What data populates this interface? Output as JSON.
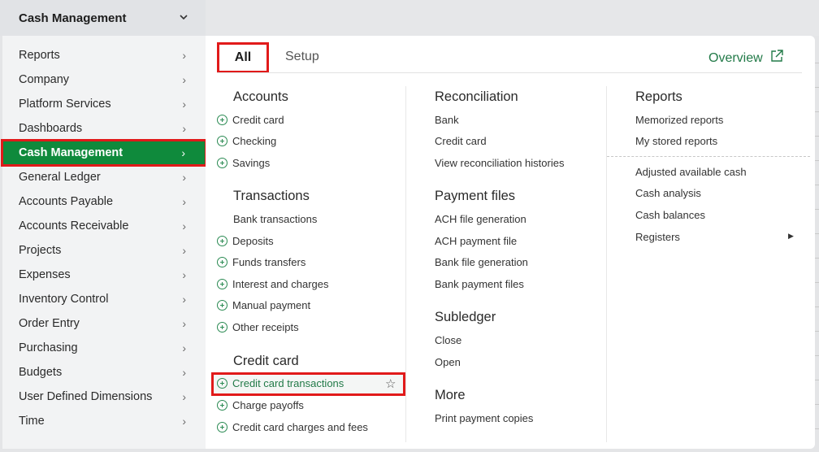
{
  "header": {
    "module": "Cash Management"
  },
  "sidebar": {
    "items": [
      {
        "label": "Reports",
        "key": "reports"
      },
      {
        "label": "Company",
        "key": "company"
      },
      {
        "label": "Platform Services",
        "key": "platform-services"
      },
      {
        "label": "Dashboards",
        "key": "dashboards"
      },
      {
        "label": "Cash Management",
        "key": "cash-management",
        "active": true
      },
      {
        "label": "General Ledger",
        "key": "general-ledger"
      },
      {
        "label": "Accounts Payable",
        "key": "accounts-payable"
      },
      {
        "label": "Accounts Receivable",
        "key": "accounts-receivable"
      },
      {
        "label": "Projects",
        "key": "projects"
      },
      {
        "label": "Expenses",
        "key": "expenses"
      },
      {
        "label": "Inventory Control",
        "key": "inventory-control"
      },
      {
        "label": "Order Entry",
        "key": "order-entry"
      },
      {
        "label": "Purchasing",
        "key": "purchasing"
      },
      {
        "label": "Budgets",
        "key": "budgets"
      },
      {
        "label": "User Defined Dimensions",
        "key": "user-defined-dimensions"
      },
      {
        "label": "Time",
        "key": "time"
      }
    ]
  },
  "tabs": {
    "all": "All",
    "setup": "Setup",
    "overview": "Overview"
  },
  "col1": {
    "accounts": {
      "title": "Accounts",
      "items": [
        {
          "label": "Credit card",
          "add": true
        },
        {
          "label": "Checking",
          "add": true
        },
        {
          "label": "Savings",
          "add": true
        }
      ]
    },
    "transactions": {
      "title": "Transactions",
      "items": [
        {
          "label": "Bank transactions",
          "add": false
        },
        {
          "label": "Deposits",
          "add": true
        },
        {
          "label": "Funds transfers",
          "add": true
        },
        {
          "label": "Interest and charges",
          "add": true
        },
        {
          "label": "Manual payment",
          "add": true
        },
        {
          "label": "Other receipts",
          "add": true
        }
      ]
    },
    "credit_card": {
      "title": "Credit card",
      "items": [
        {
          "label": "Credit card transactions",
          "add": true
        },
        {
          "label": "Charge payoffs",
          "add": true
        },
        {
          "label": "Credit card charges and fees",
          "add": true
        }
      ]
    }
  },
  "col2": {
    "reconciliation": {
      "title": "Reconciliation",
      "items": [
        {
          "label": "Bank"
        },
        {
          "label": "Credit card"
        },
        {
          "label": "View reconciliation histories"
        }
      ]
    },
    "payment_files": {
      "title": "Payment files",
      "items": [
        {
          "label": "ACH file generation"
        },
        {
          "label": "ACH payment file"
        },
        {
          "label": "Bank file generation"
        },
        {
          "label": "Bank payment files"
        }
      ]
    },
    "subledger": {
      "title": "Subledger",
      "items": [
        {
          "label": "Close"
        },
        {
          "label": "Open"
        }
      ]
    },
    "more": {
      "title": "More",
      "items": [
        {
          "label": "Print payment copies"
        }
      ]
    }
  },
  "col3": {
    "reports": {
      "title": "Reports",
      "items": [
        {
          "label": "Memorized reports"
        },
        {
          "label": "My stored reports"
        },
        {
          "label": "Adjusted available cash"
        },
        {
          "label": "Cash analysis"
        },
        {
          "label": "Cash balances"
        },
        {
          "label": "Registers"
        }
      ]
    }
  },
  "colors": {
    "accent": "#0f8a3c",
    "link_green": "#227a48",
    "highlight": "#e11a1a"
  }
}
